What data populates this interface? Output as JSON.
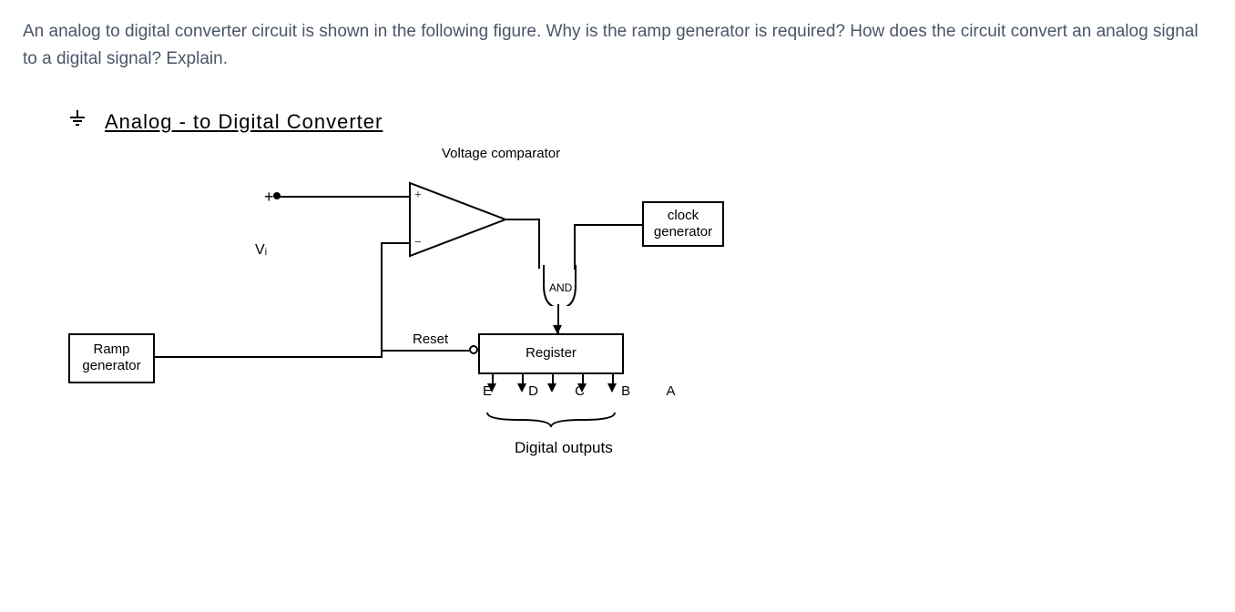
{
  "question": {
    "text": "An analog to digital converter circuit is shown in the following figure. Why is the ramp generator is required? How does the circuit convert an analog signal to a digital signal? Explain."
  },
  "diagram": {
    "title": "Analog - to    Digital    Converter",
    "ramp_label": "Ramp generator",
    "clock_label": "clock generator",
    "register_label": "Register",
    "comparator_label": "Voltage comparator",
    "vi_label": "Vᵢ",
    "reset_label": "Reset",
    "and_label": "AND",
    "output_pins": "E  D  C  B  A",
    "digital_outputs_label": "Digital outputs",
    "plus": "+",
    "minus": "−"
  }
}
